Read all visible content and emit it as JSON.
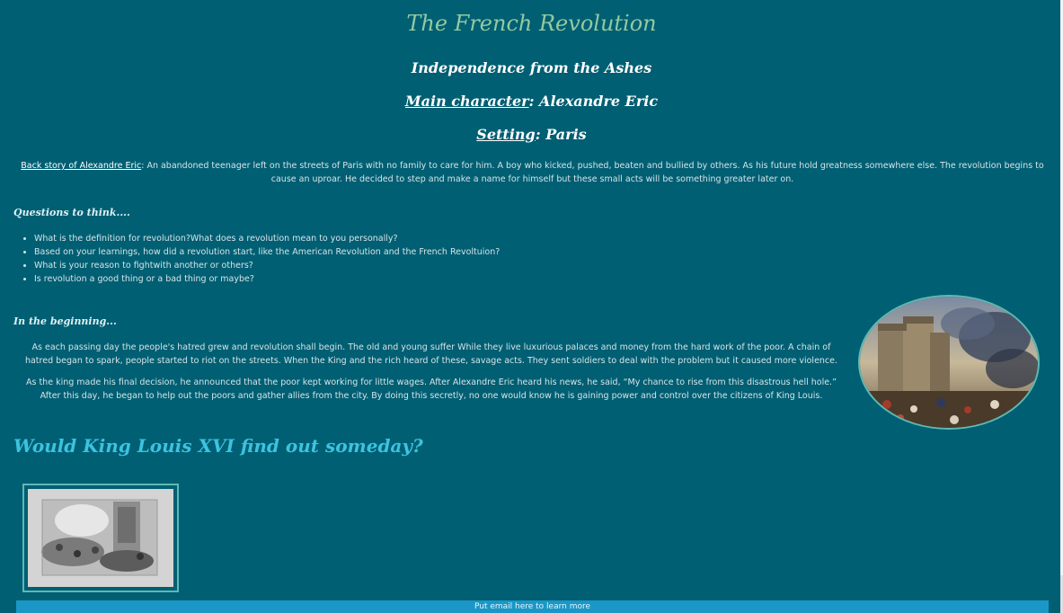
{
  "header": {
    "title": "The French Revolution",
    "subtitle": "Independence from the Ashes",
    "main_character_label": "Main character",
    "main_character_value": ": Alexandre Eric",
    "setting_label": "Setting",
    "setting_value": ": Paris"
  },
  "backstory": {
    "link_text": "Back story of Alexandre Eric",
    "text": ": An abandoned teenager left on the streets of Paris with no family to care for him. A boy who kicked, pushed, beaten and bullied by others. As his future hold greatness somewhere else. The revolution begins to cause an uproar. He decided to step and make a name for himself but these small acts will be something greater later on."
  },
  "questions": {
    "heading": "Questions to think....",
    "items": [
      "What is the definition for revolution?What does a revolution mean to you personally?",
      "Based on your learnings, how did a revolution start, like the American Revolution and the French Revoltuion?",
      "What is your reason to fightwith another or others?",
      "Is revolution a good thing or a bad thing or maybe?"
    ]
  },
  "beginning": {
    "heading": "In the beginning...",
    "paragraph1": "As each passing day the people's hatred grew and revolution shall begin. The old and young suffer While they live luxurious palaces and money from the hard work of the poor. A chain of hatred began to spark, people started to riot on the streets. When the King and the rich heard of these, savage acts. They sent soldiers to deal with the problem but it caused more violence.",
    "paragraph2": "As the king made his final decision, he announced that the poor kept working for little wages. After Alexandre Eric heard his news, he said, “My chance to rise from this disastrous hell hole.” After this day, he began to help out the poors and gather allies from the city. By doing this secretly, no one would know he is gaining power and control over the citizens of King Louis."
  },
  "question_heading": "Would King Louis XVI find out someday?",
  "email": {
    "label": "Put email here to learn more"
  },
  "colors": {
    "background": "#005f73",
    "title": "#94c9a0",
    "heading_accent": "#3cc3e0",
    "email_bar": "#1a97c7",
    "image_border": "#5fb9b3"
  }
}
